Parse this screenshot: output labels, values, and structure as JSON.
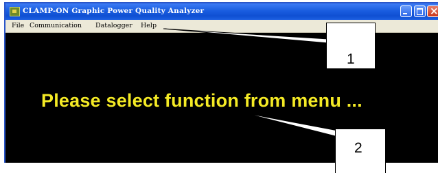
{
  "window": {
    "title": "CLAMP-ON Graphic Power Quality Analyzer"
  },
  "menubar": {
    "items": [
      "File",
      "Communication",
      "Datalogger",
      "Help"
    ]
  },
  "content": {
    "message": "Please select function from menu ..."
  },
  "callouts": {
    "labels": [
      "1",
      "2"
    ]
  }
}
